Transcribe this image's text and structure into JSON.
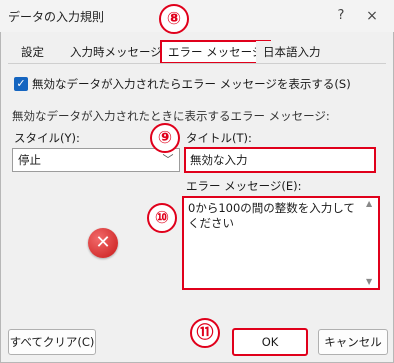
{
  "dialog": {
    "title": "データの入力規則",
    "help_glyph": "?",
    "close_glyph": "×"
  },
  "tabs": [
    {
      "label": "設定"
    },
    {
      "label": "入力時メッセージ"
    },
    {
      "label": "エラー メッセージ",
      "active": true
    },
    {
      "label": "日本語入力"
    }
  ],
  "badges": {
    "b8": "⑧",
    "b9": "⑨",
    "b10": "⑩",
    "b11": "⑪"
  },
  "show_error_checkbox": {
    "checked": true,
    "glyph": "✓",
    "label": "無効なデータが入力されたらエラー メッセージを表示する(S)"
  },
  "section_label": "無効なデータが入力されたときに表示するエラー メッセージ:",
  "style": {
    "label": "スタイル(Y):",
    "value": "停止",
    "chevron": "﹀"
  },
  "title_field": {
    "label": "タイトル(T):",
    "value": "無効な入力"
  },
  "message_field": {
    "label": "エラー メッセージ(E):",
    "value": "0から100の間の整数を入力してください",
    "scroll_up": "▲",
    "scroll_down": "▼"
  },
  "error_icon_glyph": "✕",
  "buttons": {
    "clear": "すべてクリア(C)",
    "ok": "OK",
    "cancel": "キャンセル"
  },
  "colors": {
    "highlight": "#e0001b",
    "checkbox": "#1565c0",
    "error_icon": "#c81a1a"
  }
}
